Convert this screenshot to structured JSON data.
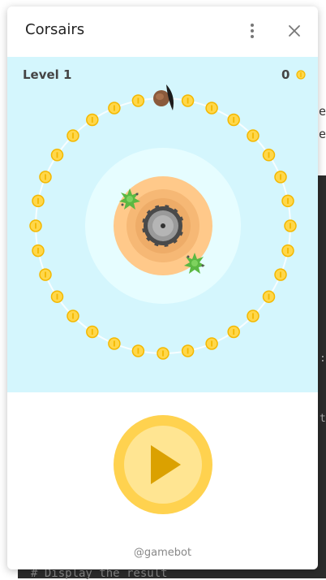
{
  "app": {
    "title": "Corsairs",
    "footer_credit": "@gamebot"
  },
  "hud": {
    "level_label": "Level 1",
    "score": "0"
  },
  "icons": {
    "menu": "more-vertical-icon",
    "close": "close-icon",
    "play": "play-icon",
    "coin": "coin-icon"
  },
  "colors": {
    "game_background": "#d4f6fd",
    "coin": "#ffd74a",
    "island": "#ffc98a",
    "play_button_outer": "#ffd24f",
    "play_button_inner": "#ffe592",
    "play_triangle": "#dba100"
  },
  "game": {
    "coins_on_ring": 32,
    "enemy_ships": 2,
    "player_ship": 1
  },
  "background": {
    "code_line": "# Display the result"
  }
}
